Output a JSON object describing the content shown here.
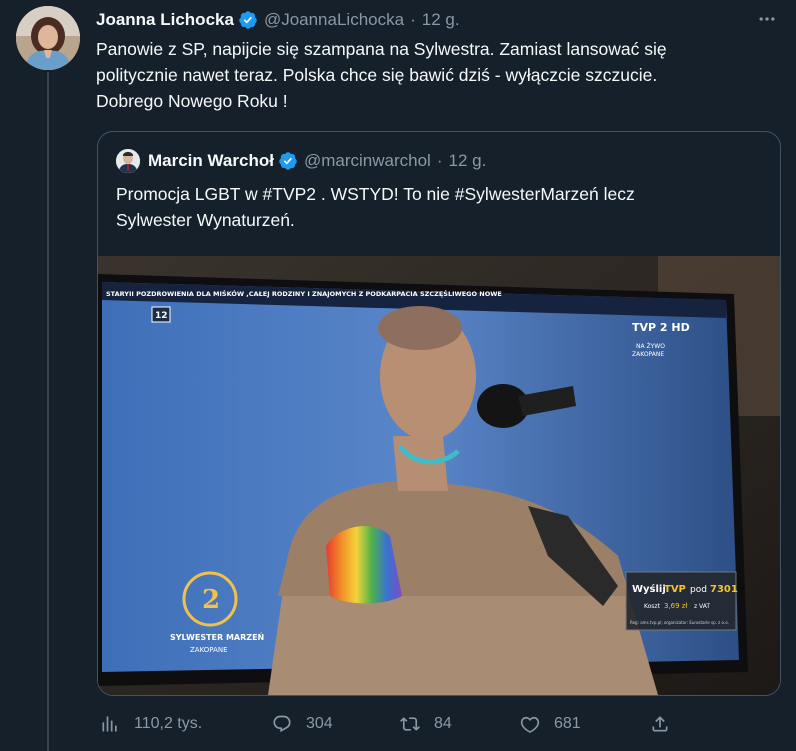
{
  "tweet": {
    "author_name": "Joanna Lichocka",
    "author_handle": "@JoannaLichocka",
    "separator": "·",
    "time": "12 g.",
    "text_lines": [
      "Panowie z SP, napijcie się szampana na Sylwestra. Zamiast lansować się",
      "politycznie nawet teraz. Polska chce się bawić dziś - wyłączcie szczucie.",
      "Dobrego Nowego Roku !"
    ],
    "more_icon": "ellipsis-icon"
  },
  "quoted_tweet": {
    "author_name": "Marcin Warchoł",
    "author_handle": "@marcinwarchol",
    "separator": "·",
    "time": "12 g.",
    "text_lines": [
      "Promocja LGBT w #TVP2 . WSTYD! To nie #SylwesterMarzeń lecz",
      "Sylwester Wynaturzeń."
    ],
    "media": {
      "ticker_text": "STARYII  POZDROWIENIA DLA MIŚKÓW ,CAŁEJ RODZINY I ZNAJOMYCH Z PODKARPACIA  SZCZĘŚLIWEGO NOWE",
      "age_rating": "12",
      "channel_logo": "TVP 2 HD",
      "live_label": "NA ŻYWO",
      "live_location": "ZAKOPANE",
      "event_logo_line1": "SYLWESTER MARZEŃ",
      "event_logo_line2": "ZAKOPANE",
      "sms_prefix": "Wyślij",
      "sms_brand": "TVP",
      "sms_middle": "pod",
      "sms_number": "7301",
      "sms_cost_label": "Koszt",
      "sms_cost": "3,69 zł",
      "sms_vat": "z VAT",
      "sms_footer": "Reg: ams.tvp.pl; organizator: Eurostarle sp. z o.o."
    }
  },
  "actions": {
    "views": "110,2 tys.",
    "replies": "304",
    "retweets": "84",
    "likes": "681",
    "icons": [
      "analytics-icon",
      "reply-icon",
      "retweet-icon",
      "like-icon",
      "share-icon"
    ]
  },
  "colors": {
    "background": "#15202b",
    "verified": "#1d9bf0",
    "secondary_text": "#8b98a5",
    "border": "#425364"
  }
}
